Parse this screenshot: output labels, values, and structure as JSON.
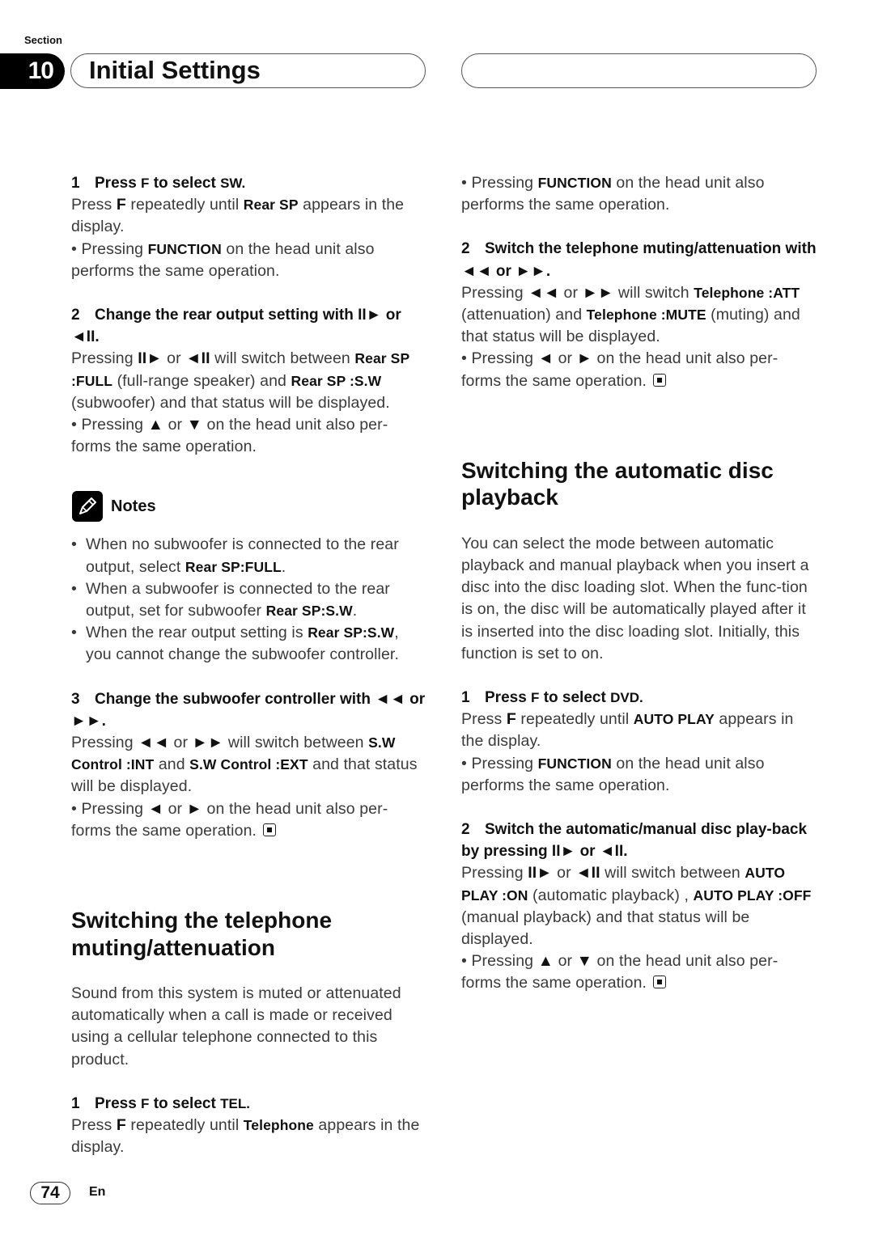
{
  "header": {
    "section_label": "Section",
    "section_number": "10",
    "title": "Initial Settings",
    "right_title": ""
  },
  "icons": {
    "play-pause": "II►",
    "pause-reverse": "◄II",
    "fast-reverse": "◄◄",
    "fast-forward": "►►",
    "up-arrow": "▲",
    "down-arrow": "▼",
    "left-arrow": "◄",
    "right-arrow": "►"
  },
  "left_column": [
    {
      "type": "step",
      "num": "1",
      "runs": [
        {
          "t": "Press "
        },
        {
          "t": "F",
          "sm": true
        },
        {
          "t": " to select "
        },
        {
          "t": "SW.",
          "sm": true
        }
      ]
    },
    {
      "type": "p",
      "runs": [
        {
          "t": "Press "
        },
        {
          "t": "F",
          "b": true
        },
        {
          "t": " repeatedly until "
        },
        {
          "t": "Rear SP",
          "kw": true
        },
        {
          "t": " appears in the display."
        }
      ]
    },
    {
      "type": "p",
      "runs": [
        {
          "t": "• Pressing "
        },
        {
          "t": "FUNCTION",
          "kw": true
        },
        {
          "t": " on the head unit also performs the same operation."
        }
      ]
    },
    {
      "type": "gap",
      "size": "s"
    },
    {
      "type": "step",
      "num": "2",
      "runs": [
        {
          "t": "Change the rear output setting with "
        },
        {
          "icon": "play-pause"
        },
        {
          "t": " or "
        },
        {
          "icon": "pause-reverse"
        },
        {
          "t": "."
        }
      ]
    },
    {
      "type": "p",
      "runs": [
        {
          "t": "Pressing "
        },
        {
          "icon": "play-pause"
        },
        {
          "t": " or "
        },
        {
          "icon": "pause-reverse"
        },
        {
          "t": " will switch between "
        },
        {
          "t": "Rear SP :FULL",
          "kw": true
        },
        {
          "t": " (full-range speaker) and "
        },
        {
          "t": "Rear SP :S.W",
          "kw": true
        },
        {
          "t": " (subwoofer) and that status will be displayed."
        }
      ]
    },
    {
      "type": "p",
      "runs": [
        {
          "t": "• Pressing "
        },
        {
          "icon": "up-arrow"
        },
        {
          "t": " or "
        },
        {
          "icon": "down-arrow"
        },
        {
          "t": " on the head unit also per-forms the same operation."
        }
      ]
    },
    {
      "type": "gap",
      "size": "m"
    },
    {
      "type": "notes",
      "title": "Notes",
      "items": [
        [
          {
            "t": "When no subwoofer is connected to the rear output, select "
          },
          {
            "t": "Rear SP:FULL",
            "kw": true
          },
          {
            "t": "."
          }
        ],
        [
          {
            "t": "When a subwoofer is connected to the rear output, set for subwoofer "
          },
          {
            "t": "Rear SP:S.W",
            "kw": true
          },
          {
            "t": "."
          }
        ],
        [
          {
            "t": "When the rear output setting is "
          },
          {
            "t": "Rear SP:S.W",
            "kw": true
          },
          {
            "t": ", you cannot change the subwoofer controller."
          }
        ]
      ]
    },
    {
      "type": "gap",
      "size": "s"
    },
    {
      "type": "step",
      "num": "3",
      "runs": [
        {
          "t": "Change the subwoofer controller with "
        },
        {
          "icon": "fast-reverse"
        },
        {
          "t": " or "
        },
        {
          "icon": "fast-forward"
        },
        {
          "t": "."
        }
      ]
    },
    {
      "type": "p",
      "runs": [
        {
          "t": "Pressing "
        },
        {
          "icon": "fast-reverse"
        },
        {
          "t": " or "
        },
        {
          "icon": "fast-forward"
        },
        {
          "t": " will switch between "
        },
        {
          "t": "S.W Control :INT",
          "kw": true
        },
        {
          "t": " and "
        },
        {
          "t": "S.W Control :EXT",
          "kw": true
        },
        {
          "t": " and that status will be displayed."
        }
      ]
    },
    {
      "type": "p",
      "end": true,
      "runs": [
        {
          "t": "• Pressing "
        },
        {
          "icon": "left-arrow"
        },
        {
          "t": " or "
        },
        {
          "icon": "right-arrow"
        },
        {
          "t": " on the head unit also per-forms the same operation."
        }
      ]
    },
    {
      "type": "gap",
      "size": "xl"
    },
    {
      "type": "h2",
      "text": "Switching the telephone muting/attenuation"
    },
    {
      "type": "gap",
      "size": "s"
    },
    {
      "type": "p",
      "runs": [
        {
          "t": "Sound from this system is muted or attenuated automatically when a call is made or received using a cellular telephone connected to this product."
        }
      ]
    },
    {
      "type": "gap",
      "size": "s"
    },
    {
      "type": "step",
      "num": "1",
      "runs": [
        {
          "t": "Press "
        },
        {
          "t": "F",
          "sm": true
        },
        {
          "t": " to select "
        },
        {
          "t": "TEL.",
          "sm": true
        }
      ]
    },
    {
      "type": "p",
      "runs": [
        {
          "t": "Press "
        },
        {
          "t": "F",
          "b": true
        },
        {
          "t": " repeatedly until "
        },
        {
          "t": "Telephone",
          "kw": true
        },
        {
          "t": " appears in the display."
        }
      ]
    }
  ],
  "right_column": [
    {
      "type": "p",
      "runs": [
        {
          "t": "• Pressing "
        },
        {
          "t": "FUNCTION",
          "kw": true
        },
        {
          "t": " on the head unit also performs the same operation."
        }
      ]
    },
    {
      "type": "gap",
      "size": "s"
    },
    {
      "type": "step",
      "num": "2",
      "runs": [
        {
          "t": "Switch the telephone muting/attenuation with "
        },
        {
          "icon": "fast-reverse"
        },
        {
          "t": " or "
        },
        {
          "icon": "fast-forward"
        },
        {
          "t": "."
        }
      ]
    },
    {
      "type": "p",
      "runs": [
        {
          "t": "Pressing "
        },
        {
          "icon": "fast-reverse"
        },
        {
          "t": " or "
        },
        {
          "icon": "fast-forward"
        },
        {
          "t": " will switch "
        },
        {
          "t": "Telephone :ATT",
          "kw": true
        },
        {
          "t": " (attenuation) and "
        },
        {
          "t": "Telephone :MUTE",
          "kw": true
        },
        {
          "t": " (muting) and that status will be displayed."
        }
      ]
    },
    {
      "type": "p",
      "end": true,
      "runs": [
        {
          "t": "• Pressing "
        },
        {
          "icon": "left-arrow"
        },
        {
          "t": " or "
        },
        {
          "icon": "right-arrow"
        },
        {
          "t": " on the head unit also per-forms the same operation."
        }
      ]
    },
    {
      "type": "gap",
      "size": "xl"
    },
    {
      "type": "h2",
      "text": "Switching the automatic disc playback"
    },
    {
      "type": "gap",
      "size": "s"
    },
    {
      "type": "p",
      "runs": [
        {
          "t": "You can select the mode between automatic playback and manual playback when you insert a disc into the disc loading slot. When the func-tion is on, the disc will be automatically played after it is inserted into the disc loading slot. Initially, this function is set to on."
        }
      ]
    },
    {
      "type": "gap",
      "size": "s"
    },
    {
      "type": "step",
      "num": "1",
      "runs": [
        {
          "t": "Press "
        },
        {
          "t": "F",
          "sm": true
        },
        {
          "t": " to select "
        },
        {
          "t": "DVD.",
          "sm": true
        }
      ]
    },
    {
      "type": "p",
      "runs": [
        {
          "t": "Press "
        },
        {
          "t": "F",
          "b": true
        },
        {
          "t": " repeatedly until "
        },
        {
          "t": "AUTO PLAY",
          "kw": true
        },
        {
          "t": " appears in the display."
        }
      ]
    },
    {
      "type": "p",
      "runs": [
        {
          "t": "• Pressing "
        },
        {
          "t": "FUNCTION",
          "kw": true
        },
        {
          "t": " on the head unit also performs the same operation."
        }
      ]
    },
    {
      "type": "gap",
      "size": "s"
    },
    {
      "type": "step",
      "num": "2",
      "runs": [
        {
          "t": "Switch the automatic/manual disc play-back by pressing "
        },
        {
          "icon": "play-pause"
        },
        {
          "t": " or "
        },
        {
          "icon": "pause-reverse"
        },
        {
          "t": "."
        }
      ]
    },
    {
      "type": "p",
      "runs": [
        {
          "t": "Pressing "
        },
        {
          "icon": "play-pause"
        },
        {
          "t": " or "
        },
        {
          "icon": "pause-reverse"
        },
        {
          "t": " will switch between "
        },
        {
          "t": "AUTO PLAY :ON",
          "kw": true
        },
        {
          "t": " (automatic playback) , "
        },
        {
          "t": "AUTO PLAY :OFF",
          "kw": true
        },
        {
          "t": " (manual playback) and that status will be displayed."
        }
      ]
    },
    {
      "type": "p",
      "end": true,
      "runs": [
        {
          "t": "• Pressing "
        },
        {
          "icon": "up-arrow"
        },
        {
          "t": " or "
        },
        {
          "icon": "down-arrow"
        },
        {
          "t": " on the head unit also per-forms the same operation."
        }
      ]
    }
  ],
  "footer": {
    "page_number": "74",
    "language": "En"
  }
}
